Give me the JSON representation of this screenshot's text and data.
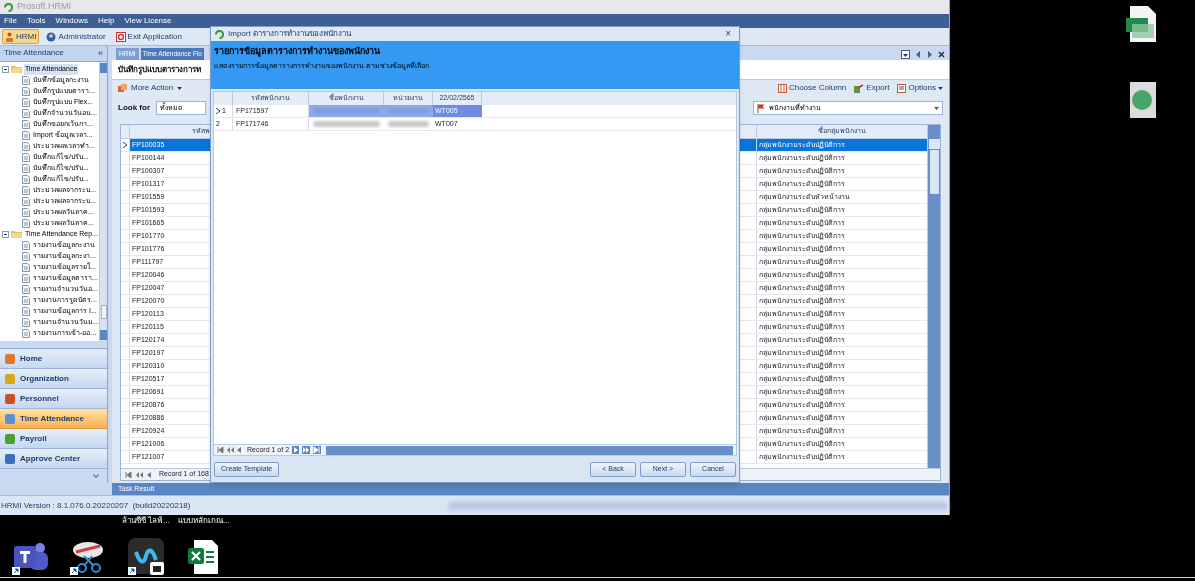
{
  "app": {
    "title": "Prosoft HRMI",
    "menu": [
      "File",
      "Tools",
      "Windows",
      "Help",
      "View License"
    ],
    "toolbar": [
      {
        "label": "HRMI",
        "selected": true
      },
      {
        "label": "Administrator",
        "selected": false
      },
      {
        "label": "Exit Application",
        "selected": false
      }
    ]
  },
  "sidebar": {
    "title": "Time Attendance",
    "collapse": "«",
    "tree": [
      {
        "label": "Time Attendance",
        "expanded": true,
        "selected": true,
        "children": [
          {
            "label": "บันทึกข้อมูลกะงาน"
          },
          {
            "label": "บันทึกรูปแบบตารา..."
          },
          {
            "label": "บันทึกรูปแบบ Flex..."
          },
          {
            "label": "บันทึกจำนวนวันอน..."
          },
          {
            "label": "บันทึกขอยกเว้นกา..."
          },
          {
            "label": "Import ข้อมูลเวลา..."
          },
          {
            "label": "ประมวลผลเวลาทำ..."
          },
          {
            "label": "บันทึกแก้ไข/ปรับ..."
          },
          {
            "label": "บันทึกแก้ไข/ปรับ..."
          },
          {
            "label": "บันทึกแก้ไข/ปรับ..."
          },
          {
            "label": "ประมวลผลจากระบ..."
          },
          {
            "label": "ประมวลผลจากระบ..."
          },
          {
            "label": "ประมวลผลวันลาค..."
          },
          {
            "label": "ประมวลผลวันลาค..."
          }
        ]
      },
      {
        "label": "Time Attendance Rep...",
        "expanded": true,
        "selected": false,
        "children": [
          {
            "label": "รายงานข้อมูลกะงาน"
          },
          {
            "label": "รายงานข้อมูลกะงา..."
          },
          {
            "label": "รายงานข้อมูลรายใ..."
          },
          {
            "label": "รายงานข้อมูลตารา..."
          },
          {
            "label": "รายงานจำนวนวันอ..."
          },
          {
            "label": "รายงานการรูดบัตร..."
          },
          {
            "label": "รายงานข้อมูลการ I..."
          },
          {
            "label": "รายงานจำนวนวันม..."
          },
          {
            "label": "รายงานการเข้า-ออ..."
          }
        ]
      }
    ],
    "nav": [
      {
        "label": "Home",
        "selected": false,
        "color": "#e0782c"
      },
      {
        "label": "Organization",
        "selected": false,
        "color": "#d9a520"
      },
      {
        "label": "Personnel",
        "selected": false,
        "color": "#c8502a"
      },
      {
        "label": "Time Attendance",
        "selected": true,
        "color": "#5a8fd0"
      },
      {
        "label": "Payroll",
        "selected": false,
        "color": "#4aa02c"
      },
      {
        "label": "Approve Center",
        "selected": false,
        "color": "#3a6ec0"
      }
    ]
  },
  "main": {
    "tabs": [
      {
        "label": "HRMI",
        "selected": false
      },
      {
        "label": "Time Attendance Flo",
        "selected": true
      }
    ],
    "heading": "บันทึกรูปแบบตารางการท",
    "more_action": "More Action",
    "look_for": {
      "label": "Look for",
      "value": "ทั้งหมด"
    },
    "tools": [
      "Choose Column",
      "Export",
      "Options"
    ],
    "filter": {
      "value": "พนักงานที่ทำงาน"
    },
    "columns": [
      "รหัสพ",
      "ชื่อกลุ่มพนักงาน"
    ],
    "rows": [
      {
        "code": "FP100035",
        "group": "กลุ่มพนักงานระดับปฏิบัติการ",
        "selected": true
      },
      {
        "code": "FP100144",
        "group": "กลุ่มพนักงานระดับปฏิบัติการ",
        "selected": false
      },
      {
        "code": "FP100307",
        "group": "กลุ่มพนักงานระดับปฏิบัติการ",
        "selected": false
      },
      {
        "code": "FP101317",
        "group": "กลุ่มพนักงานระดับปฏิบัติการ",
        "selected": false
      },
      {
        "code": "FP101559",
        "group": "กลุ่มพนักงานระดับหัวหน้างาน",
        "selected": false
      },
      {
        "code": "FP101593",
        "group": "กลุ่มพนักงานระดับปฏิบัติการ",
        "selected": false
      },
      {
        "code": "FP101665",
        "group": "กลุ่มพนักงานระดับปฏิบัติการ",
        "selected": false
      },
      {
        "code": "FP101770",
        "group": "กลุ่มพนักงานระดับปฏิบัติการ",
        "selected": false
      },
      {
        "code": "FP101776",
        "group": "กลุ่มพนักงานระดับปฏิบัติการ",
        "selected": false
      },
      {
        "code": "FP111797",
        "group": "กลุ่มพนักงานระดับปฏิบัติการ",
        "selected": false
      },
      {
        "code": "FP120046",
        "group": "กลุ่มพนักงานระดับปฏิบัติการ",
        "selected": false
      },
      {
        "code": "FP120047",
        "group": "กลุ่มพนักงานระดับปฏิบัติการ",
        "selected": false
      },
      {
        "code": "FP120070",
        "group": "กลุ่มพนักงานระดับปฏิบัติการ",
        "selected": false
      },
      {
        "code": "FP120113",
        "group": "กลุ่มพนักงานระดับปฏิบัติการ",
        "selected": false
      },
      {
        "code": "FP120115",
        "group": "กลุ่มพนักงานระดับปฏิบัติการ",
        "selected": false
      },
      {
        "code": "FP120174",
        "group": "กลุ่มพนักงานระดับปฏิบัติการ",
        "selected": false
      },
      {
        "code": "FP120197",
        "group": "กลุ่มพนักงานระดับปฏิบัติการ",
        "selected": false
      },
      {
        "code": "FP120310",
        "group": "กลุ่มพนักงานระดับปฏิบัติการ",
        "selected": false
      },
      {
        "code": "FP120517",
        "group": "กลุ่มพนักงานระดับปฏิบัติการ",
        "selected": false
      },
      {
        "code": "FP120691",
        "group": "กลุ่มพนักงานระดับปฏิบัติการ",
        "selected": false
      },
      {
        "code": "FP120876",
        "group": "กลุ่มพนักงานระดับปฏิบัติการ",
        "selected": false
      },
      {
        "code": "FP120886",
        "group": "กลุ่มพนักงานระดับปฏิบัติการ",
        "selected": false
      },
      {
        "code": "FP120924",
        "group": "กลุ่มพนักงานระดับปฏิบัติการ",
        "selected": false
      },
      {
        "code": "FP121006",
        "group": "กลุ่มพนักงานระดับปฏิบัติการ",
        "selected": false
      },
      {
        "code": "FP121007",
        "group": "กลุ่มพนักงานระดับปฏิบัติการ",
        "selected": false
      }
    ],
    "pager": "Record 1 of 168"
  },
  "task_result": "Task Result",
  "status_bar": {
    "version": "HRMI Version : 8.1.076.0.20220207  (build20220218)"
  },
  "dialog": {
    "title": "Import ตารางการทำงานของพนักงาน",
    "close": "×",
    "heading": "รายการข้อมูลตารางการทำงานของพนักงาน",
    "subtitle": "แสดงรายการข้อมูลตารางการทำงานของพนักงาน ตามช่วงข้อมูลที่เลือก",
    "columns": [
      "รหัสพนักงาน",
      "ชื่อพนักงาน",
      "หน่วยงาน",
      "22/02/2565"
    ],
    "rows": [
      {
        "number": "1",
        "code": "FP171597",
        "shift": "WT005",
        "selected": true
      },
      {
        "number": "2",
        "code": "FP171746",
        "shift": "WT007",
        "selected": false
      }
    ],
    "pager": "Record 1 of 2",
    "buttons": [
      "Create Template",
      "< Back",
      "Next >",
      "Cancel"
    ]
  },
  "desktop": {
    "labels": [
      "ล้านซีซี ไลฟ์...",
      "แบบหลักเกณ..."
    ]
  }
}
